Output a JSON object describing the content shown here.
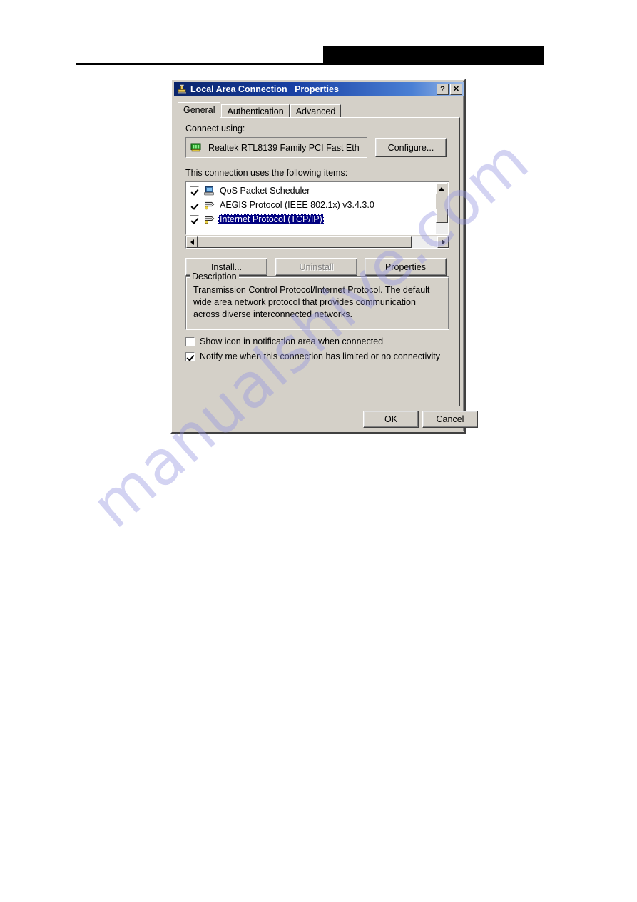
{
  "page": {
    "watermark_text": "manualshive.com",
    "redaction_bar": "",
    "watermark_color": "#9696e1"
  },
  "dialog": {
    "title": "Local Area Connection   Properties",
    "title_icon": "network-connection-icon",
    "accent_color": "#0a246a",
    "face_color": "#d4d0c8",
    "selection_color": "#000080",
    "titlebar_buttons": [
      {
        "name": "help-button",
        "label": "?"
      },
      {
        "name": "close-button",
        "label": "✕"
      }
    ],
    "tabs": [
      {
        "label": "General",
        "active": true
      },
      {
        "label": "Authentication",
        "active": false
      },
      {
        "label": "Advanced",
        "active": false
      }
    ],
    "connect_using": {
      "label": "Connect using:",
      "adapter": "Realtek RTL8139 Family PCI Fast Eth",
      "adapter_icon": "network-adapter-icon",
      "configure_button": "Configure..."
    },
    "items_section": {
      "label": "This connection uses the following items:",
      "items": [
        {
          "label": "QoS Packet Scheduler",
          "checked": true,
          "selected": false,
          "icon": "computer-service-icon"
        },
        {
          "label": "AEGIS Protocol (IEEE 802.1x) v3.4.3.0",
          "checked": true,
          "selected": false,
          "icon": "network-protocol-icon"
        },
        {
          "label": "Internet Protocol (TCP/IP)",
          "checked": true,
          "selected": true,
          "icon": "network-protocol-icon"
        }
      ]
    },
    "action_buttons": [
      {
        "name": "install-button",
        "label": "Install...",
        "disabled": false
      },
      {
        "name": "uninstall-button",
        "label": "Uninstall",
        "disabled": true
      },
      {
        "name": "properties-button",
        "label": "Properties",
        "disabled": false
      }
    ],
    "description": {
      "legend": "Description",
      "text": "Transmission Control Protocol/Internet Protocol. The default wide area network protocol that provides communication across diverse interconnected networks."
    },
    "options": [
      {
        "label": "Show icon in notification area when connected",
        "checked": false,
        "name": "show-icon-checkbox"
      },
      {
        "label": "Notify me when this connection has limited or no connectivity",
        "checked": true,
        "name": "notify-checkbox"
      }
    ],
    "footer_buttons": [
      {
        "name": "ok-button",
        "label": "OK"
      },
      {
        "name": "cancel-button",
        "label": "Cancel"
      }
    ]
  }
}
